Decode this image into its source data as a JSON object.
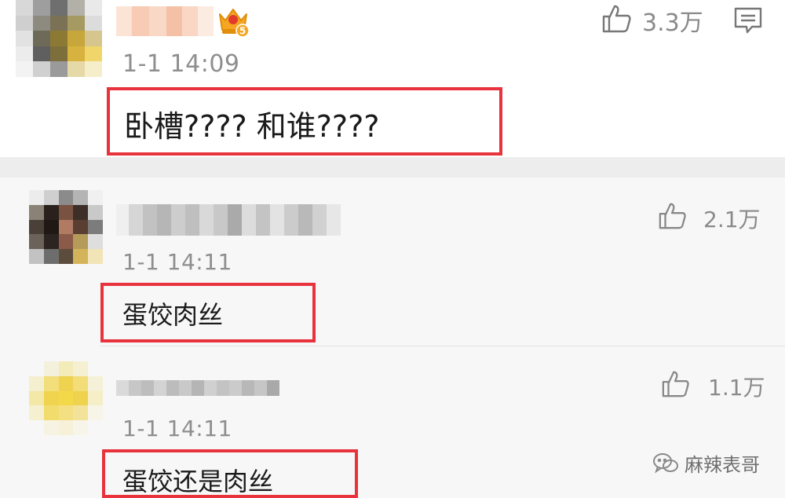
{
  "comments": [
    {
      "time": "1-1 14:09",
      "likes": "3.3万",
      "text": "卧槽???? 和谁????",
      "vip_level": "5"
    },
    {
      "time": "1-1 14:11",
      "likes": "2.1万",
      "text": "蛋饺肉丝"
    },
    {
      "time": "1-1 14:11",
      "likes": "1.1万",
      "text": "蛋饺还是肉丝"
    }
  ],
  "watermark": {
    "text": "麻辣表哥"
  },
  "colors": {
    "highlight_border": "#e8323c",
    "reply_background": "#f7f7f7",
    "divider": "#ebebeb",
    "vip_badge": "#f5a623"
  },
  "icons": {
    "like": "thumbs-up-icon",
    "reply": "comment-icon",
    "vip": "crown-badge-icon",
    "watermark": "wechat-icon"
  }
}
